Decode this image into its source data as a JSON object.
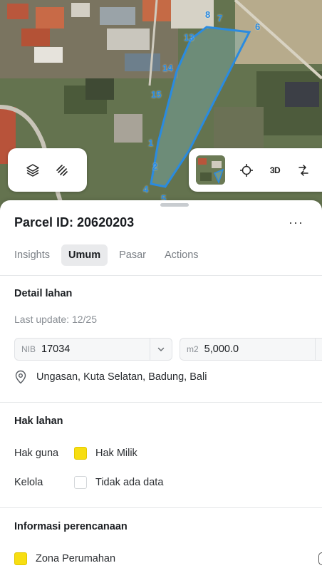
{
  "map": {
    "parcel_labels": [
      "8",
      "7",
      "6",
      "13",
      "14",
      "15",
      "1",
      "2",
      "4",
      "5"
    ],
    "accent_color": "#2a8be0",
    "controls": {
      "layers_icon": "layers-icon",
      "draw_icon": "draw-tool-icon",
      "locate_icon": "crosshair-icon",
      "btn_3d": "3D",
      "share_icon": "share-icon"
    }
  },
  "parcel": {
    "title": "Parcel ID: 20620203",
    "more": "···"
  },
  "tabs": [
    {
      "label": "Insights",
      "active": false
    },
    {
      "label": "Umum",
      "active": true
    },
    {
      "label": "Pasar",
      "active": false
    },
    {
      "label": "Actions",
      "active": false
    }
  ],
  "detail": {
    "title": "Detail lahan",
    "last_update": "Last update: 12/25",
    "nib_prefix": "NIB",
    "nib_value": "17034",
    "area_prefix": "m2",
    "area_value": "5,000.0",
    "address": "Ungasan, Kuta Selatan, Badung, Bali"
  },
  "hak": {
    "title": "Hak lahan",
    "hak_guna_label": "Hak guna",
    "hak_guna_value": "Hak Milik",
    "hak_guna_color": "#f7de12",
    "kelola_label": "Kelola",
    "kelola_value": "Tidak ada data"
  },
  "perencanaan": {
    "title": "Informasi perencanaan",
    "zona_value": "Zona Perumahan",
    "zona_color": "#f7de12"
  }
}
